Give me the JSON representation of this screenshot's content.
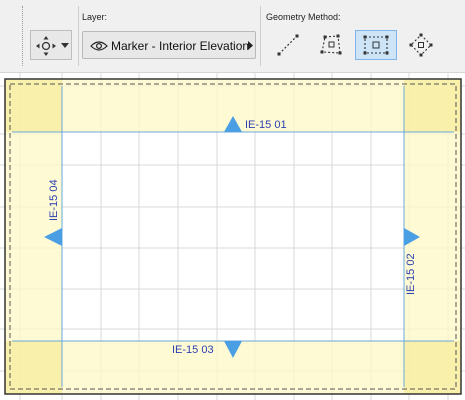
{
  "toolbar": {
    "layer": {
      "section_label": "Layer:",
      "selected_layer": "Marker - Interior Elevation"
    },
    "geometry": {
      "section_label": "Geometry Method:",
      "methods": [
        {
          "icon": "line-method-icon",
          "selected": false
        },
        {
          "icon": "polygon-method-icon",
          "selected": false
        },
        {
          "icon": "rectangle-method-icon",
          "selected": true
        },
        {
          "icon": "rotated-rectangle-method-icon",
          "selected": false
        }
      ]
    }
  },
  "markers": {
    "top": "IE-15 01",
    "right": "IE-15 02",
    "bottom": "IE-15 03",
    "left": "IE-15 04"
  },
  "colors": {
    "highlight": "#fdf8c5",
    "corner_highlight": "#f8eea0",
    "marker": "#4a9ee3",
    "label": "#2b3fb0",
    "grid": "#d9d9d9"
  }
}
